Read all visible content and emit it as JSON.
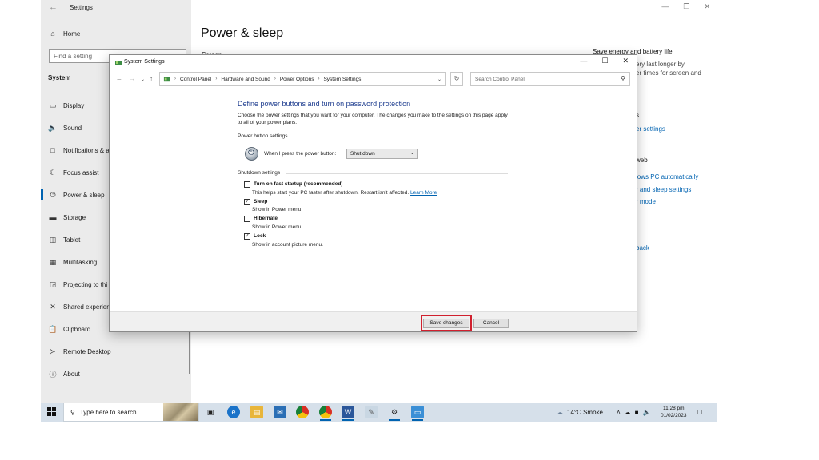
{
  "settings": {
    "window_title": "Settings",
    "home_label": "Home",
    "search_placeholder": "Find a setting",
    "section_label": "System",
    "nav_items": [
      {
        "label": "Display",
        "icon": "display-icon"
      },
      {
        "label": "Sound",
        "icon": "sound-icon"
      },
      {
        "label": "Notifications & a",
        "icon": "notifications-icon"
      },
      {
        "label": "Focus assist",
        "icon": "focus-assist-icon"
      },
      {
        "label": "Power & sleep",
        "icon": "power-icon",
        "active": true
      },
      {
        "label": "Storage",
        "icon": "storage-icon"
      },
      {
        "label": "Tablet",
        "icon": "tablet-icon"
      },
      {
        "label": "Multitasking",
        "icon": "multitasking-icon"
      },
      {
        "label": "Projecting to thi",
        "icon": "projecting-icon"
      },
      {
        "label": "Shared experien",
        "icon": "shared-experiences-icon"
      },
      {
        "label": "Clipboard",
        "icon": "clipboard-icon"
      },
      {
        "label": "Remote Desktop",
        "icon": "remote-desktop-icon"
      },
      {
        "label": "About",
        "icon": "about-icon"
      }
    ],
    "page_title": "Power & sleep",
    "peek_left": "Screen",
    "side_heading": "Save energy and battery life",
    "side_text_1": "ery last longer by",
    "side_text_2": "er times for screen and",
    "side_peek_s": "s",
    "side_link_1": "er settings",
    "side_peek_web": "web",
    "side_link_2": "lows PC automatically",
    "side_link_3": "r and sleep settings",
    "side_link_4": "r mode",
    "side_link_5": "back"
  },
  "dialog": {
    "title": "System Settings",
    "breadcrumb": [
      "Control Panel",
      "Hardware and Sound",
      "Power Options",
      "System Settings"
    ],
    "search_placeholder": "Search Control Panel",
    "heading": "Define power buttons and turn on password protection",
    "description": "Choose the power settings that you want for your computer. The changes you make to the settings on this page apply to all of your power plans.",
    "power_button_section": "Power button settings",
    "power_button_prompt": "When I press the power button:",
    "power_button_value": "Shut down",
    "shutdown_section": "Shutdown settings",
    "options": [
      {
        "label": "Turn on fast startup (recommended)",
        "checked": false,
        "sub": "This helps start your PC faster after shutdown. Restart isn't affected.",
        "link": "Learn More"
      },
      {
        "label": "Sleep",
        "checked": true,
        "sub": "Show in Power menu."
      },
      {
        "label": "Hibernate",
        "checked": false,
        "sub": "Show in Power menu."
      },
      {
        "label": "Lock",
        "checked": true,
        "sub": "Show in account picture menu."
      }
    ],
    "save_button": "Save changes",
    "cancel_button": "Cancel"
  },
  "taskbar": {
    "search_placeholder": "Type here to search",
    "weather": "14°C  Smoke",
    "time": "11:28 pm",
    "date": "01/02/2023"
  },
  "colors": {
    "accent": "#0063b1",
    "highlight": "#d0202e",
    "heading": "#1e3d8f"
  }
}
